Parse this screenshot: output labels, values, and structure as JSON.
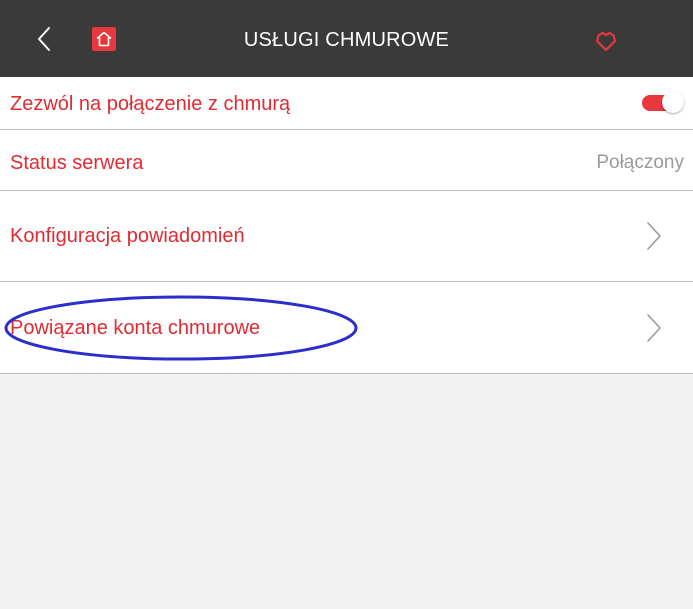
{
  "header": {
    "title": "USŁUGI CHMUROWE",
    "back_icon": "chevron-left-icon",
    "home_icon": "home-icon",
    "shield_icon": "shield-icon"
  },
  "settings": {
    "cloud_connection": {
      "label": "Zezwól na połączenie z chmurą",
      "enabled": true
    },
    "server_status": {
      "label": "Status serwera",
      "value": "Połączony"
    },
    "notification_config": {
      "label": "Konfiguracja powiadomień"
    },
    "linked_accounts": {
      "label": "Powiązane konta chmurowe"
    }
  },
  "colors": {
    "accent": "#e02b33",
    "header_bg": "#3a3a3a",
    "highlight": "#2b2ecb",
    "muted_text": "#9a9a9a"
  }
}
